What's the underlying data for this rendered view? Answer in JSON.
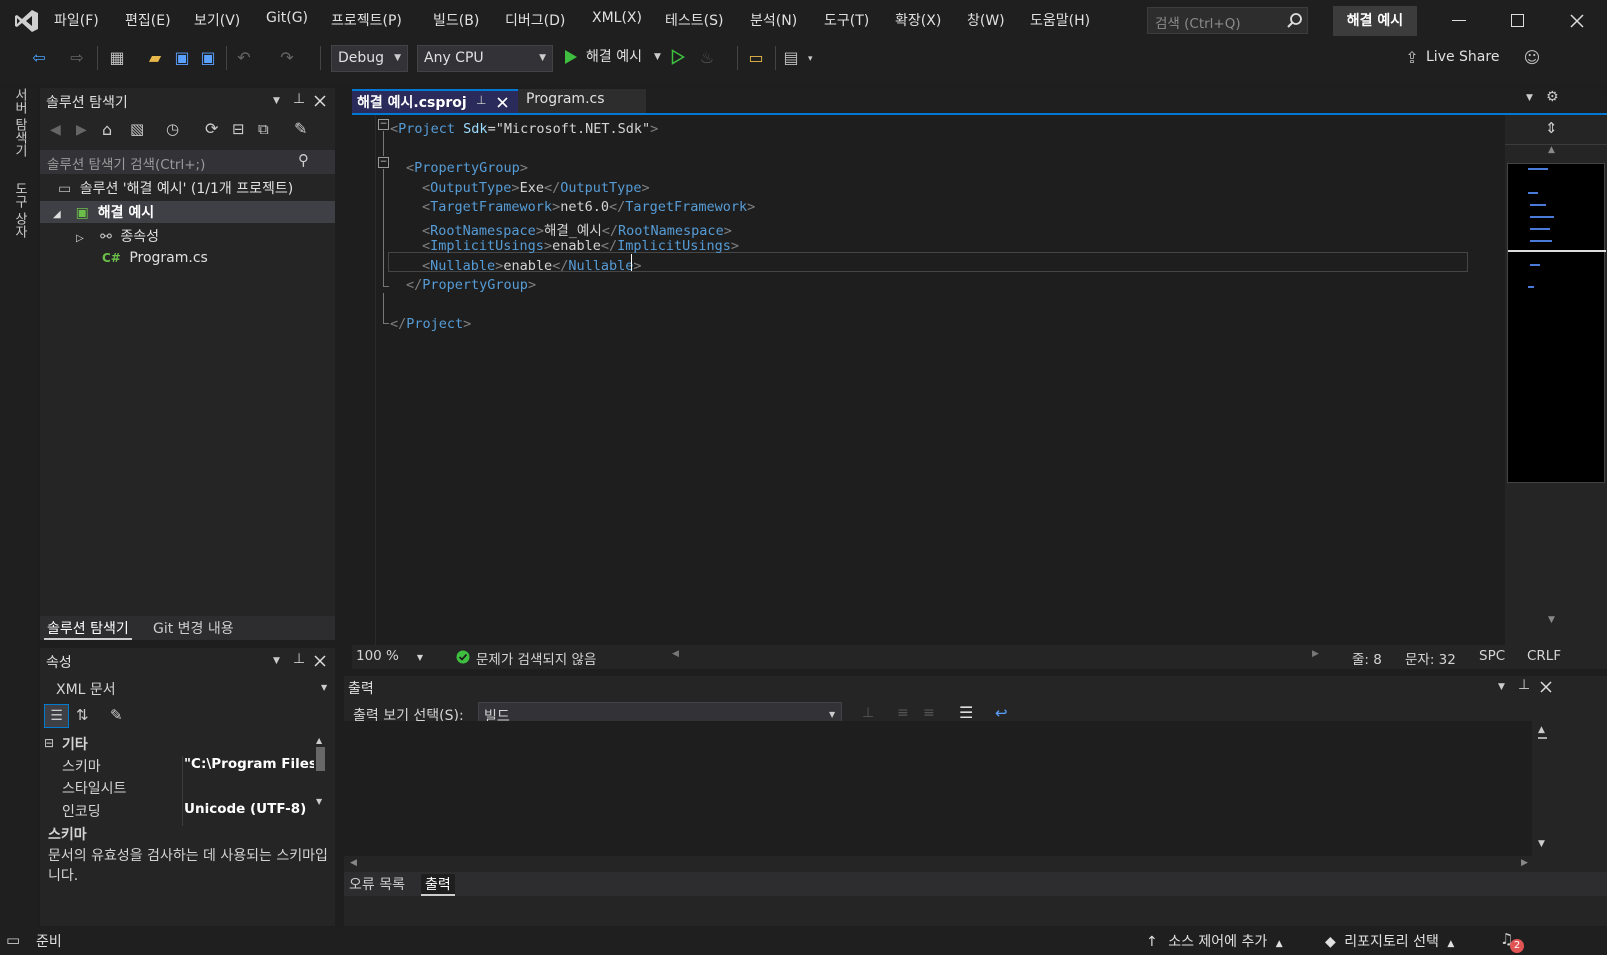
{
  "menu": {
    "items": [
      "파일(F)",
      "편집(E)",
      "보기(V)",
      "Git(G)",
      "프로젝트(P)",
      "빌드(B)",
      "디버그(D)",
      "XML(X)",
      "테스트(S)",
      "분석(N)",
      "도구(T)",
      "확장(X)",
      "창(W)",
      "도움말(H)"
    ],
    "search_placeholder": "검색 (Ctrl+Q)",
    "window_title": "해결 예시"
  },
  "toolbar": {
    "config": "Debug",
    "platform": "Any CPU",
    "run_label": "해결 예시",
    "live_share": "Live Share"
  },
  "left_strip": {
    "tabs": [
      "서버 탐색기",
      "도구 상자"
    ]
  },
  "solution_explorer": {
    "title": "솔루션 탐색기",
    "search_placeholder": "솔루션 탐색기 검색(Ctrl+;)",
    "solution": "솔루션 '해결 예시' (1/1개 프로젝트)",
    "project": "해결 예시",
    "dependencies": "종속성",
    "file": "Program.cs",
    "tabs": [
      "솔루션 탐색기",
      "Git 변경 내용"
    ]
  },
  "properties": {
    "title": "속성",
    "object": "XML 문서",
    "category": "기타",
    "rows": [
      {
        "name": "스키마",
        "value": "\"C:\\Program Files"
      },
      {
        "name": "스타일시트",
        "value": ""
      },
      {
        "name": "인코딩",
        "value": "Unicode (UTF-8)"
      }
    ],
    "desc_title": "스키마",
    "desc_text": "문서의 유효성을 검사하는 데 사용되는 스키마입니다."
  },
  "editor": {
    "tabs": [
      {
        "label": "해결 예시.csproj",
        "active": true
      },
      {
        "label": "Program.cs",
        "active": false
      }
    ],
    "lines": [
      {
        "indent": 0,
        "parts": [
          {
            "t": "<",
            "c": "bracket"
          },
          {
            "t": "Project",
            "c": "tag"
          },
          {
            "t": " Sdk",
            "c": "attr"
          },
          {
            "t": "=\"Microsoft.NET.Sdk\"",
            "c": "str"
          },
          {
            "t": ">",
            "c": "bracket"
          }
        ]
      },
      {
        "indent": 0,
        "parts": []
      },
      {
        "indent": 1,
        "parts": [
          {
            "t": "<",
            "c": "bracket"
          },
          {
            "t": "PropertyGroup",
            "c": "tag"
          },
          {
            "t": ">",
            "c": "bracket"
          }
        ]
      },
      {
        "indent": 2,
        "parts": [
          {
            "t": "<",
            "c": "bracket"
          },
          {
            "t": "OutputType",
            "c": "tag"
          },
          {
            "t": ">",
            "c": "bracket"
          },
          {
            "t": "Exe",
            "c": "txt"
          },
          {
            "t": "</",
            "c": "bracket"
          },
          {
            "t": "OutputType",
            "c": "tag"
          },
          {
            "t": ">",
            "c": "bracket"
          }
        ]
      },
      {
        "indent": 2,
        "parts": [
          {
            "t": "<",
            "c": "bracket"
          },
          {
            "t": "TargetFramework",
            "c": "tag"
          },
          {
            "t": ">",
            "c": "bracket"
          },
          {
            "t": "net6.0",
            "c": "txt"
          },
          {
            "t": "</",
            "c": "bracket"
          },
          {
            "t": "TargetFramework",
            "c": "tag"
          },
          {
            "t": ">",
            "c": "bracket"
          }
        ]
      },
      {
        "indent": 2,
        "parts": [
          {
            "t": "<",
            "c": "bracket"
          },
          {
            "t": "RootNamespace",
            "c": "tag"
          },
          {
            "t": ">",
            "c": "bracket"
          },
          {
            "t": "해결_예시",
            "c": "txt"
          },
          {
            "t": "</",
            "c": "bracket"
          },
          {
            "t": "RootNamespace",
            "c": "tag"
          },
          {
            "t": ">",
            "c": "bracket"
          }
        ]
      },
      {
        "indent": 2,
        "parts": [
          {
            "t": "<",
            "c": "bracket"
          },
          {
            "t": "ImplicitUsings",
            "c": "tag"
          },
          {
            "t": ">",
            "c": "bracket"
          },
          {
            "t": "enable",
            "c": "txt"
          },
          {
            "t": "</",
            "c": "bracket"
          },
          {
            "t": "ImplicitUsings",
            "c": "tag"
          },
          {
            "t": ">",
            "c": "bracket"
          }
        ]
      },
      {
        "indent": 2,
        "parts": [
          {
            "t": "<",
            "c": "bracket"
          },
          {
            "t": "Nullable",
            "c": "tag"
          },
          {
            "t": ">",
            "c": "bracket"
          },
          {
            "t": "enable",
            "c": "txt"
          },
          {
            "t": "</",
            "c": "bracket"
          },
          {
            "t": "Nullable",
            "c": "tag"
          },
          {
            "t": ">",
            "c": "bracket"
          }
        ]
      },
      {
        "indent": 1,
        "parts": [
          {
            "t": "</",
            "c": "bracket"
          },
          {
            "t": "PropertyGroup",
            "c": "tag"
          },
          {
            "t": ">",
            "c": "bracket"
          }
        ]
      },
      {
        "indent": 0,
        "parts": []
      },
      {
        "indent": 0,
        "parts": [
          {
            "t": "</",
            "c": "bracket"
          },
          {
            "t": "Project",
            "c": "tag"
          },
          {
            "t": ">",
            "c": "bracket"
          }
        ]
      }
    ],
    "zoom": "100 %",
    "issues": "문제가 검색되지 않음",
    "line": "줄: 8",
    "col": "문자: 32",
    "spc": "SPC",
    "eol": "CRLF"
  },
  "output": {
    "title": "출력",
    "source_label": "출력 보기 선택(S):",
    "source_value": "빌드",
    "tabs": [
      "오류 목록",
      "출력"
    ]
  },
  "status": {
    "ready": "준비",
    "source_control": "소스 제어에 추가",
    "repo": "리포지토리 선택",
    "notifications": "2"
  }
}
